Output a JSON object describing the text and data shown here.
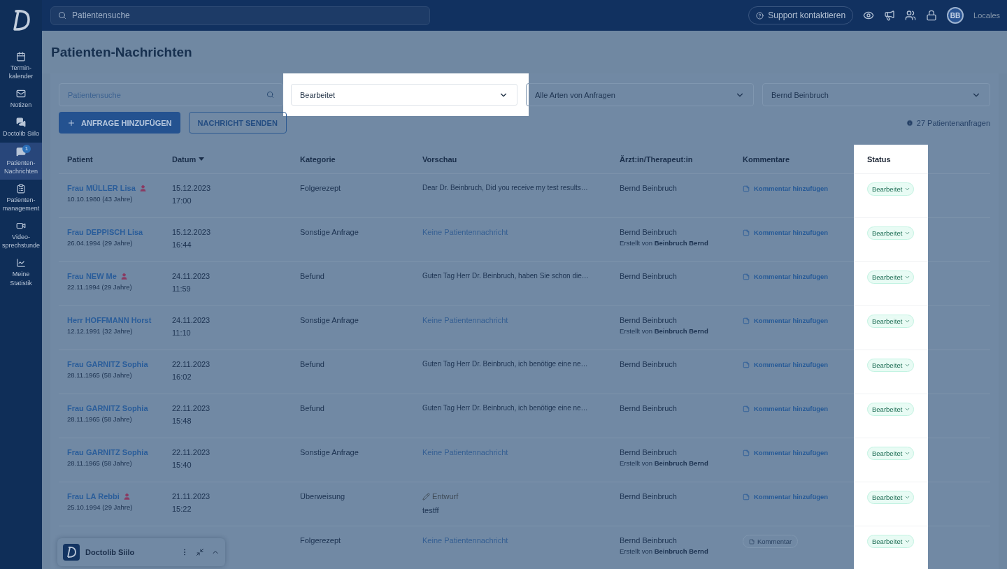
{
  "topbar": {
    "search_placeholder": "Patientensuche",
    "support": "Support kontaktieren",
    "avatar": "BB",
    "locale": "Locales"
  },
  "sidebar": {
    "items": [
      {
        "label": "Termin-kalender",
        "selected": false
      },
      {
        "label": "Notizen",
        "selected": false
      },
      {
        "label": "Doctolib Siilo",
        "selected": false
      },
      {
        "label": "Patienten-Nachrichten",
        "selected": true,
        "badge": "1"
      },
      {
        "label": "Patienten-management",
        "selected": false
      },
      {
        "label": "Video-sprechstunde",
        "selected": false
      },
      {
        "label": "Meine Statistik",
        "selected": false
      }
    ]
  },
  "page_title": "Patienten-Nachrichten",
  "filters": {
    "search_placeholder": "Patientensuche",
    "status": "Bearbeitet",
    "type": "Alle Arten von Anfragen",
    "doctor": "Bernd Beinbruch"
  },
  "buttons": [
    {
      "label": "ANFRAGE HINZUFÜGEN",
      "kind": "primary"
    },
    {
      "label": "NACHRICHT SENDEN",
      "kind": "outline"
    }
  ],
  "count": "27 Patientenanfragen",
  "table": {
    "columns": [
      {
        "label": "Patient",
        "sorted": false
      },
      {
        "label": "Datum",
        "sorted": true
      },
      {
        "label": "Kategorie",
        "sorted": false
      },
      {
        "label": "Vorschau",
        "sorted": false
      },
      {
        "label": "Ärzt:in/Therapeut:in",
        "sorted": false
      },
      {
        "label": "Kommentare",
        "sorted": false
      },
      {
        "label": "Status",
        "sorted": false
      }
    ],
    "rows": [
      {
        "patient": "Frau MÜLLER Lisa",
        "account": true,
        "birth": "10.10.1980 (43 Jahre)",
        "date": "15.12.2023",
        "time": "17:00",
        "category": "Folgerezept",
        "preview": {
          "kind": "message",
          "text": "Dear Dr. Beinbruch, Did you receive my test results…"
        },
        "doctor": "Bernd Beinbruch",
        "comment": {
          "kind": "link",
          "label": "Kommentar hinzufügen"
        },
        "status": "Bearbeitet"
      },
      {
        "patient": "Frau DEPPISCH Lisa",
        "account": false,
        "birth": "26.04.1994 (29 Jahre)",
        "date": "15.12.2023",
        "time": "16:44",
        "category": "Sonstige Anfrage",
        "preview": {
          "kind": "none",
          "text": "Keine Patientennachricht"
        },
        "doctor": "Bernd Beinbruch",
        "created_by": "Erstellt von **Beinbruch Bernd**",
        "comment": {
          "kind": "link",
          "label": "Kommentar hinzufügen"
        },
        "status": "Bearbeitet"
      },
      {
        "patient": "Frau NEW Me",
        "account": true,
        "birth": "22.11.1994 (29 Jahre)",
        "date": "24.11.2023",
        "time": "11:59",
        "category": "Befund",
        "preview": {
          "kind": "message",
          "text": "Guten Tag Herr Dr. Beinbruch, haben Sie schon die…"
        },
        "doctor": "Bernd Beinbruch",
        "comment": {
          "kind": "link",
          "label": "Kommentar hinzufügen"
        },
        "status": "Bearbeitet"
      },
      {
        "patient": "Herr HOFFMANN Horst",
        "account": false,
        "birth": "12.12.1991 (32 Jahre)",
        "date": "24.11.2023",
        "time": "11:10",
        "category": "Sonstige Anfrage",
        "preview": {
          "kind": "none",
          "text": "Keine Patientennachricht"
        },
        "doctor": "Bernd Beinbruch",
        "created_by": "Erstellt von **Beinbruch Bernd**",
        "comment": {
          "kind": "link",
          "label": "Kommentar hinzufügen"
        },
        "status": "Bearbeitet"
      },
      {
        "patient": "Frau GARNITZ Sophia",
        "account": false,
        "birth": "28.11.1965 (58 Jahre)",
        "date": "22.11.2023",
        "time": "16:02",
        "category": "Befund",
        "preview": {
          "kind": "message",
          "text": "Guten Tag Herr Dr. Beinbruch, ich benötige eine ne…"
        },
        "doctor": "Bernd Beinbruch",
        "comment": {
          "kind": "link",
          "label": "Kommentar hinzufügen"
        },
        "status": "Bearbeitet"
      },
      {
        "patient": "Frau GARNITZ Sophia",
        "account": false,
        "birth": "28.11.1965 (58 Jahre)",
        "date": "22.11.2023",
        "time": "15:48",
        "category": "Befund",
        "preview": {
          "kind": "message",
          "text": "Guten Tag Herr Dr. Beinbruch, ich benötige eine ne…"
        },
        "doctor": "Bernd Beinbruch",
        "comment": {
          "kind": "link",
          "label": "Kommentar hinzufügen"
        },
        "status": "Bearbeitet"
      },
      {
        "patient": "Frau GARNITZ Sophia",
        "account": false,
        "birth": "28.11.1965 (58 Jahre)",
        "date": "22.11.2023",
        "time": "15:40",
        "category": "Sonstige Anfrage",
        "preview": {
          "kind": "none",
          "text": "Keine Patientennachricht"
        },
        "doctor": "Bernd Beinbruch",
        "created_by": "Erstellt von **Beinbruch Bernd**",
        "comment": {
          "kind": "link",
          "label": "Kommentar hinzufügen"
        },
        "status": "Bearbeitet"
      },
      {
        "patient": "Frau LA Rebbi",
        "account": true,
        "birth": "25.10.1994 (29 Jahre)",
        "date": "21.11.2023",
        "time": "15:22",
        "category": "Überweisung",
        "preview": {
          "kind": "draft",
          "label": "Entwurf",
          "text": "testff"
        },
        "doctor": "Bernd Beinbruch",
        "comment": {
          "kind": "link",
          "label": "Kommentar hinzufügen"
        },
        "status": "Bearbeitet"
      },
      {
        "category": "Folgerezept",
        "preview": {
          "kind": "none",
          "text": "Keine Patientennachricht"
        },
        "doctor": "Bernd Beinbruch",
        "created_by": "Erstellt von **Beinbruch Bernd**",
        "comment": {
          "kind": "chip",
          "label": "Kommentar"
        },
        "status": "Bearbeitet"
      }
    ]
  },
  "widget": {
    "title": "Doctolib Siilo"
  }
}
